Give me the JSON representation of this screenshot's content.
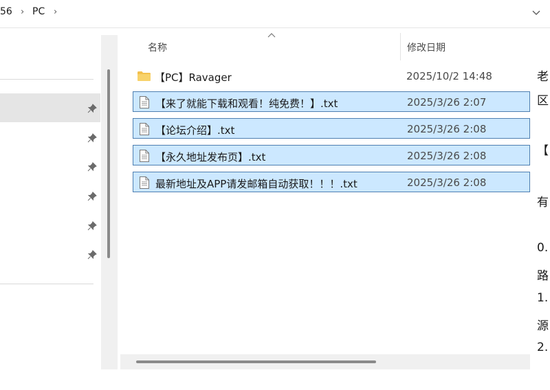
{
  "address_bar": {
    "crumbs": [
      "56",
      "PC"
    ],
    "separator": "›"
  },
  "columns": {
    "name": "名称",
    "date": "修改日期"
  },
  "files": [
    {
      "name": "【PC】Ravager",
      "date": "2025/10/2 14:48",
      "type": "folder",
      "selected": false
    },
    {
      "name": "【来了就能下载和观看！纯免费！】.txt",
      "date": "2025/3/26 2:07",
      "type": "txt",
      "selected": true
    },
    {
      "name": "【论坛介绍】.txt",
      "date": "2025/3/26 2:08",
      "type": "txt",
      "selected": true
    },
    {
      "name": "【永久地址发布页】.txt",
      "date": "2025/3/26 2:08",
      "type": "txt",
      "selected": true
    },
    {
      "name": "最新地址及APP请发邮箱自动获取！！！.txt",
      "date": "2025/3/26 2:08",
      "type": "txt",
      "selected": true
    }
  ],
  "preview": {
    "lines": [
      "老",
      "区",
      "【",
      "有",
      "0.",
      "路",
      "1.",
      "源",
      "2."
    ]
  },
  "icons": {
    "pin": "pin-icon",
    "folder": "folder-icon",
    "text_file": "text-file-icon",
    "sort": "sort-up-icon",
    "dropdown": "chevron-down-icon"
  },
  "colors": {
    "selection_bg": "#cce8ff",
    "selection_border": "#4d7eb0",
    "folder": "#f3c04d"
  }
}
